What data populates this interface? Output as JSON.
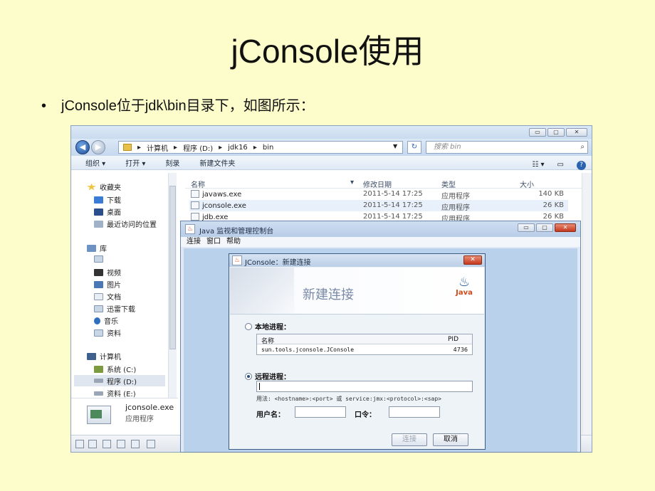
{
  "slide": {
    "title": "jConsole使用",
    "bullet_dot": "•",
    "bullet_text": "jConsole位于jdk\\bin目录下，如图所示："
  },
  "explorer": {
    "window_buttons": [
      "▭",
      "▢",
      "✕"
    ],
    "nav_back": "◀",
    "nav_forward": "▶",
    "address": {
      "crumbs": [
        "▸",
        "计算机",
        "▸",
        "程序 (D:)",
        "▸",
        "jdk16",
        "▸",
        "bin"
      ],
      "dropdown": "▼",
      "refresh": "↻"
    },
    "search": {
      "placeholder": "搜索 bin",
      "icon": "⌕"
    },
    "toolbar": {
      "organize": "组织 ▾",
      "open": "打开 ▾",
      "burn": "刻录",
      "new_folder": "新建文件夹",
      "views": "☷ ▾",
      "preview": "▭",
      "help": "?"
    },
    "nav": {
      "favorites": "收藏夹",
      "downloads": "下载",
      "desktop": "桌面",
      "recent": "最近访问的位置",
      "library": "库",
      "videos": "视频",
      "pictures": "图片",
      "documents": "文档",
      "thunder": "迅雷下载",
      "music": "音乐",
      "materials": "资料",
      "computer": "计算机",
      "drive_c": "系统 (C:)",
      "drive_d": "程序 (D:)",
      "drive_e": "资料 (E:)"
    },
    "columns": {
      "name": "名称",
      "modified": "修改日期",
      "type": "类型",
      "size": "大小",
      "sort_indicator": "▾"
    },
    "files": [
      {
        "name": "javaws.exe",
        "date": "2011-5-14 17:25",
        "type": "应用程序",
        "size": "140 KB"
      },
      {
        "name": "jconsole.exe",
        "date": "2011-5-14 17:25",
        "type": "应用程序",
        "size": "26 KB"
      },
      {
        "name": "jdb.exe",
        "date": "2011-5-14 17:25",
        "type": "应用程序",
        "size": "26 KB"
      }
    ],
    "details": {
      "name": "jconsole.exe",
      "type": "应用程序"
    }
  },
  "java_window": {
    "title": "Java 监视和管理控制台",
    "icon_glyph": "♨",
    "menu": [
      "连接",
      "窗口",
      "帮助"
    ],
    "window_buttons": [
      "▭",
      "▢",
      "✕"
    ]
  },
  "dialog": {
    "title": "JConsole：新建连接",
    "close": "✕",
    "banner_heading": "新建连接",
    "java_logo_text": "Java",
    "java_logo_cup": "♨",
    "local_label": "本地进程：",
    "local_selected": false,
    "table_headers": {
      "name": "名称",
      "pid": "PID"
    },
    "processes": [
      {
        "name": "sun.tools.jconsole.JConsole",
        "pid": "4736"
      }
    ],
    "remote_label": "远程进程：",
    "remote_selected": true,
    "remote_value": "",
    "hint": "用法: <hostname>:<port> 或 service:jmx:<protocol>:<sap>",
    "username_label": "用户名：",
    "password_label": "口令：",
    "connect_button": "连接",
    "cancel_button": "取消"
  },
  "colors": {
    "slide_background": "#fdfdcb",
    "window_chrome": "#c9dbef",
    "close_red": "#c4391e",
    "java_orange": "#d04a1a"
  }
}
